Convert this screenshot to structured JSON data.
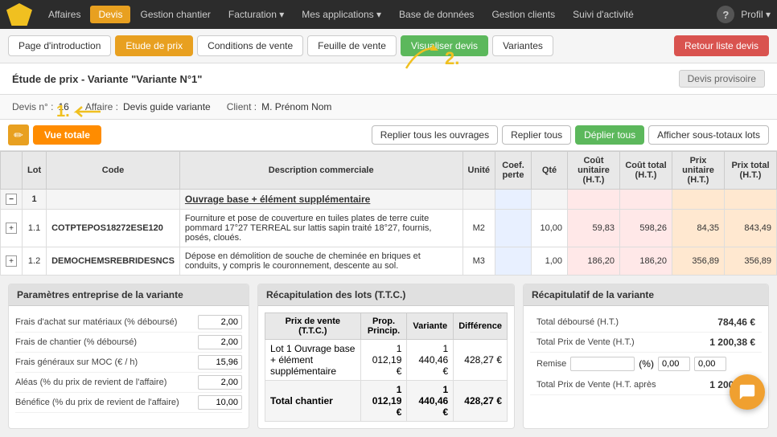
{
  "nav": {
    "logo_alt": "logo",
    "items": [
      {
        "label": "Affaires",
        "active": false
      },
      {
        "label": "Devis",
        "active": true
      },
      {
        "label": "Gestion chantier",
        "active": false
      },
      {
        "label": "Facturation",
        "active": false,
        "has_arrow": true
      },
      {
        "label": "Mes applications",
        "active": false,
        "has_arrow": true
      },
      {
        "label": "Base de données",
        "active": false
      },
      {
        "label": "Gestion clients",
        "active": false
      },
      {
        "label": "Suivi d'activité",
        "active": false
      }
    ],
    "help_label": "?",
    "profil_label": "Profil ▾"
  },
  "tabs": [
    {
      "label": "Page d'introduction",
      "active": false,
      "style": "default"
    },
    {
      "label": "Etude de prix",
      "active": false,
      "style": "orange"
    },
    {
      "label": "Conditions de vente",
      "active": false,
      "style": "default"
    },
    {
      "label": "Feuille de vente",
      "active": false,
      "style": "default"
    },
    {
      "label": "Visualiser devis",
      "active": true,
      "style": "green"
    },
    {
      "label": "Variantes",
      "active": false,
      "style": "default"
    },
    {
      "label": "Retour liste devis",
      "active": false,
      "style": "red"
    }
  ],
  "section": {
    "title": "Étude de prix - Variante \"Variante N°1\"",
    "status": "Devis provisoire"
  },
  "info_bar": {
    "devis_label": "Devis n° :",
    "devis_value": "16",
    "affaire_label": "Affaire :",
    "affaire_value": "Devis guide variante",
    "client_label": "Client :",
    "client_value": "M. Prénom Nom"
  },
  "toolbar": {
    "vue_totale_label": "Vue totale",
    "replier_ouvrages_label": "Replier tous les ouvrages",
    "replier_tous_label": "Replier tous",
    "deplier_tous_label": "Déplier tous",
    "afficher_sous_totaux_label": "Afficher sous-totaux lots",
    "annotation_1": "1.",
    "annotation_2": "2."
  },
  "table": {
    "headers": [
      {
        "label": "",
        "key": "ctrl"
      },
      {
        "label": "Lot",
        "key": "lot"
      },
      {
        "label": "Code",
        "key": "code"
      },
      {
        "label": "Description commerciale",
        "key": "desc"
      },
      {
        "label": "Unité",
        "key": "unit"
      },
      {
        "label": "Coef. perte",
        "key": "coef"
      },
      {
        "label": "Qté",
        "key": "qty"
      },
      {
        "label": "Coût unitaire (H.T.)",
        "key": "cout_unit"
      },
      {
        "label": "Coût total (H.T.)",
        "key": "cout_total"
      },
      {
        "label": "Prix unitaire (H.T.)",
        "key": "prix_unit"
      },
      {
        "label": "Prix total (H.T.)",
        "key": "prix_total"
      }
    ],
    "rows": [
      {
        "type": "group",
        "ctrl": "−",
        "lot": "1",
        "code": "",
        "desc": "Ouvrage base + élément supplémentaire",
        "unit": "",
        "coef": "",
        "qty": "",
        "cout_unit": "",
        "cout_total": "",
        "prix_unit": "",
        "prix_total": ""
      },
      {
        "type": "sub",
        "ctrl": "+",
        "lot": "1.1",
        "code": "COTPTEPOS18272ESE120",
        "desc": "Fourniture et pose de couverture en tuiles plates de terre cuite pommard 17°27 TERREAL sur lattis sapin traité 18°27, fournis, posés, cloués.",
        "unit": "M2",
        "coef": "",
        "qty": "10,00",
        "cout_unit": "59,83",
        "cout_total": "598,26",
        "prix_unit": "84,35",
        "prix_total": "843,49"
      },
      {
        "type": "sub",
        "ctrl": "+",
        "lot": "1.2",
        "code": "DEMOCHEMSREBRIDESNCS",
        "desc": "Dépose en démolition de souche de cheminée en briques et conduits, y compris le couronnement, descente au sol.",
        "unit": "M3",
        "coef": "",
        "qty": "1,00",
        "cout_unit": "186,20",
        "cout_total": "186,20",
        "prix_unit": "356,89",
        "prix_total": "356,89"
      }
    ]
  },
  "bottom": {
    "left_panel": {
      "title": "Paramètres entreprise de la variante",
      "params": [
        {
          "label": "Frais d'achat sur matériaux (% déboursé)",
          "value": "2,00"
        },
        {
          "label": "Frais de chantier (% déboursé)",
          "value": "2,00"
        },
        {
          "label": "Frais généraux sur MOC (€ / h)",
          "value": "15,96"
        },
        {
          "label": "Aléas (% du prix de revient de l'affaire)",
          "value": "2,00"
        },
        {
          "label": "Bénéfice (% du prix de revient de l'affaire)",
          "value": "10,00"
        }
      ]
    },
    "mid_panel": {
      "title": "Récapitulation des lots (T.T.C.)",
      "headers": [
        "Prix de vente (T.T.C.)",
        "Prop. Princip.",
        "Variante",
        "Différence"
      ],
      "rows": [
        {
          "label": "Lot 1 Ouvrage base + élément supplémentaire",
          "prop": "1 012,19 €",
          "variante": "1 440,46 €",
          "diff": "428,27 €"
        }
      ],
      "total_row": {
        "label": "Total chantier",
        "prop": "1 012,19 €",
        "variante": "1 440,46 €",
        "diff": "428,27 €"
      }
    },
    "right_panel": {
      "title": "Récapitulatif de la variante",
      "rows": [
        {
          "label": "Total déboursé (H.T.)",
          "value": "784,46 €"
        },
        {
          "label": "Total Prix de Vente (H.T.)",
          "value": "1 200,38 €"
        }
      ],
      "remise_label": "Remise",
      "remise_pct_label": "(%)",
      "remise_pct_value": "0,00",
      "remise_euro_value": "0,00",
      "total_apres_label": "Total Prix de Vente (H.T. après",
      "total_apres_value": "1 200,38 €"
    }
  }
}
